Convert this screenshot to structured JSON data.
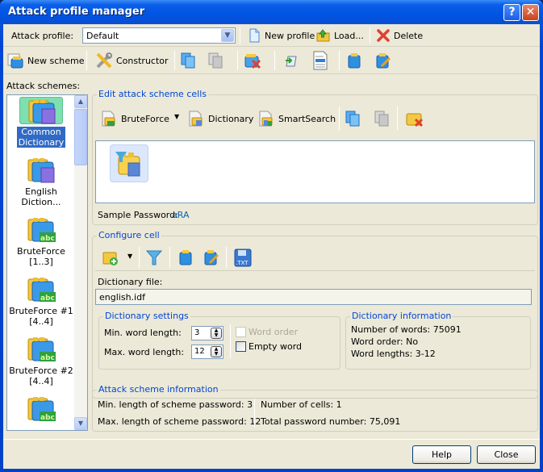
{
  "window": {
    "title": "Attack profile manager",
    "help_glyph": "?",
    "close_glyph": "✕"
  },
  "profile_bar": {
    "label": "Attack profile:",
    "selected": "Default",
    "new_profile": "New profile",
    "load": "Load...",
    "delete": "Delete"
  },
  "scheme_toolbar": {
    "new_scheme": "New scheme",
    "constructor": "Constructor",
    "icons": [
      "copy-icon",
      "paste-icon",
      "delete-scheme-icon",
      "import-icon",
      "document-icon",
      "open-icon",
      "edit-icon"
    ]
  },
  "schemes": {
    "label": "Attack schemes:",
    "items": [
      {
        "line1": "Common",
        "line2": "Dictionary",
        "type": "dictionary",
        "selected": true
      },
      {
        "line1": "English",
        "line2": "Diction...",
        "type": "dictionary",
        "selected": false
      },
      {
        "line1": "BruteForce",
        "line2": "[1..3]",
        "type": "bruteforce",
        "selected": false
      },
      {
        "line1": "BruteForce #1",
        "line2": "[4..4]",
        "type": "bruteforce",
        "selected": false
      },
      {
        "line1": "BruteForce #2",
        "line2": "[4..4]",
        "type": "bruteforce",
        "selected": false
      },
      {
        "line1": "",
        "line2": "",
        "type": "bruteforce",
        "selected": false
      }
    ],
    "abc_glyph": "abc"
  },
  "edit_cells": {
    "title": "Edit attack scheme cells",
    "bruteforce": "BruteForce",
    "dictionary": "Dictionary",
    "smartsearch": "SmartSearch",
    "sample_label": "Sample Password:",
    "sample_value": "aRA"
  },
  "configure": {
    "title": "Configure cell",
    "dict_file_label": "Dictionary file:",
    "dict_file_value": "english.idf",
    "txt_glyph": ".TXT",
    "settings": {
      "title": "Dictionary settings",
      "min_label": "Min. word length:",
      "min_value": "3",
      "max_label": "Max. word length:",
      "max_value": "12",
      "word_order": "Word order",
      "empty_word": "Empty word"
    },
    "info": {
      "title": "Dictionary information",
      "words": "Number of words: 75091",
      "order": "Word order: No",
      "lengths": "Word lengths: 3-12"
    }
  },
  "scheme_info": {
    "title": "Attack scheme information",
    "min": "Min. length of scheme password: 3",
    "max": "Max. length of scheme password: 12",
    "cells": "Number of cells: 1",
    "total": "Total password number: 75,091"
  },
  "footer": {
    "help": "Help",
    "close": "Close"
  }
}
